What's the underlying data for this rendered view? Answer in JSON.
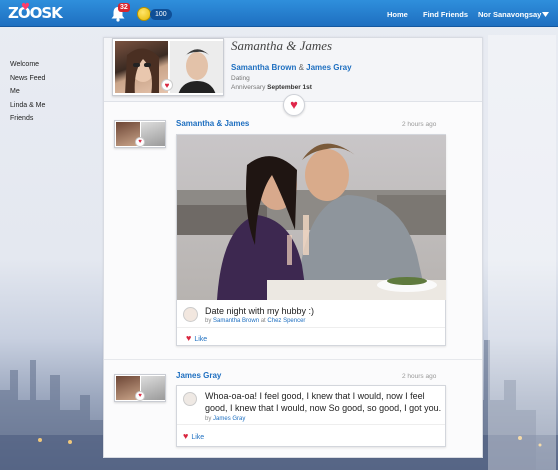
{
  "topbar": {
    "logo": "ZOOSK",
    "notification_count": "32",
    "coin_count": "100",
    "nav": {
      "home": "Home",
      "find_friends": "Find Friends",
      "user": "Nor Sanavongsay"
    }
  },
  "sidebar": {
    "items": [
      "Welcome",
      "News Feed",
      "Me",
      "Linda & Me",
      "Friends"
    ]
  },
  "couple": {
    "title": "Samantha & James",
    "name1": "Samantha Brown",
    "amp": "&",
    "name2": "James Gray",
    "status": "Dating",
    "anniversary_label": "Anniversary",
    "anniversary_date": "September 1st"
  },
  "posts": [
    {
      "author": "Samantha & James",
      "time": "2 hours ago",
      "caption": "Date night with my hubby :)",
      "by_prefix": "by",
      "by_name": "Samantha Brown",
      "at_prefix": "at",
      "place": "Chez Spencer",
      "like": "Like"
    },
    {
      "author": "James Gray",
      "time": "2 hours ago",
      "text_line1": "Whoa-oa-oa! I feel good, I knew that I would, now I feel",
      "text_line2": "good, I knew that I would, now So good, so good, I got you.",
      "by_prefix": "by",
      "by_name": "James Gray",
      "like": "Like"
    }
  ],
  "icons": {
    "notification": "bell-icon",
    "coins": "coin-icon",
    "dropdown": "caret-down-icon",
    "heart": "heart-icon"
  },
  "colors": {
    "brand": "#1e6fc0",
    "heart": "#d9263f",
    "badge": "#d9262e"
  }
}
